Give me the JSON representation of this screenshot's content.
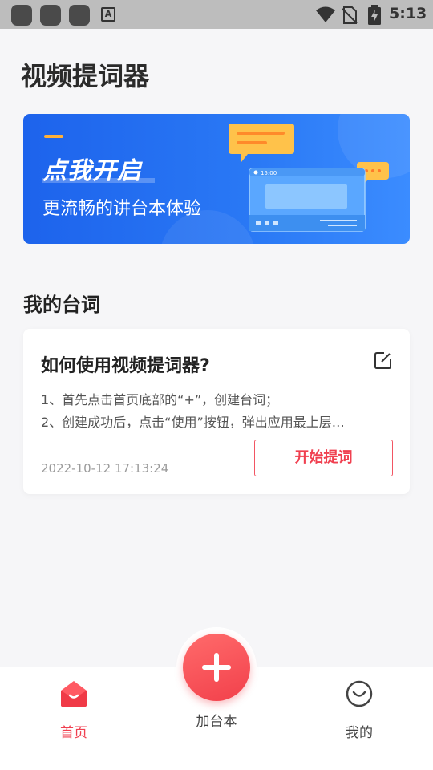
{
  "status_bar": {
    "time": "5:13",
    "a_icon_label": "A"
  },
  "page": {
    "title": "视频提词器"
  },
  "banner": {
    "heading": "点我开启",
    "subtitle": "更流畅的讲台本体验",
    "screen_time": "15:00"
  },
  "section": {
    "title": "我的台词"
  },
  "script_card": {
    "title": "如何使用视频提词器?",
    "line1": "1、首先点击首页底部的“+”，创建台词；",
    "line2": "2、创建成功后，点击“使用”按钮，弹出应用最上层…",
    "date": "2022-10-12 17:13:24",
    "start_label": "开始提词"
  },
  "bottom_nav": {
    "home_label": "首页",
    "add_label": "加台本",
    "mine_label": "我的"
  },
  "colors": {
    "accent": "#f04050",
    "banner_blue": "#1d63ec"
  }
}
